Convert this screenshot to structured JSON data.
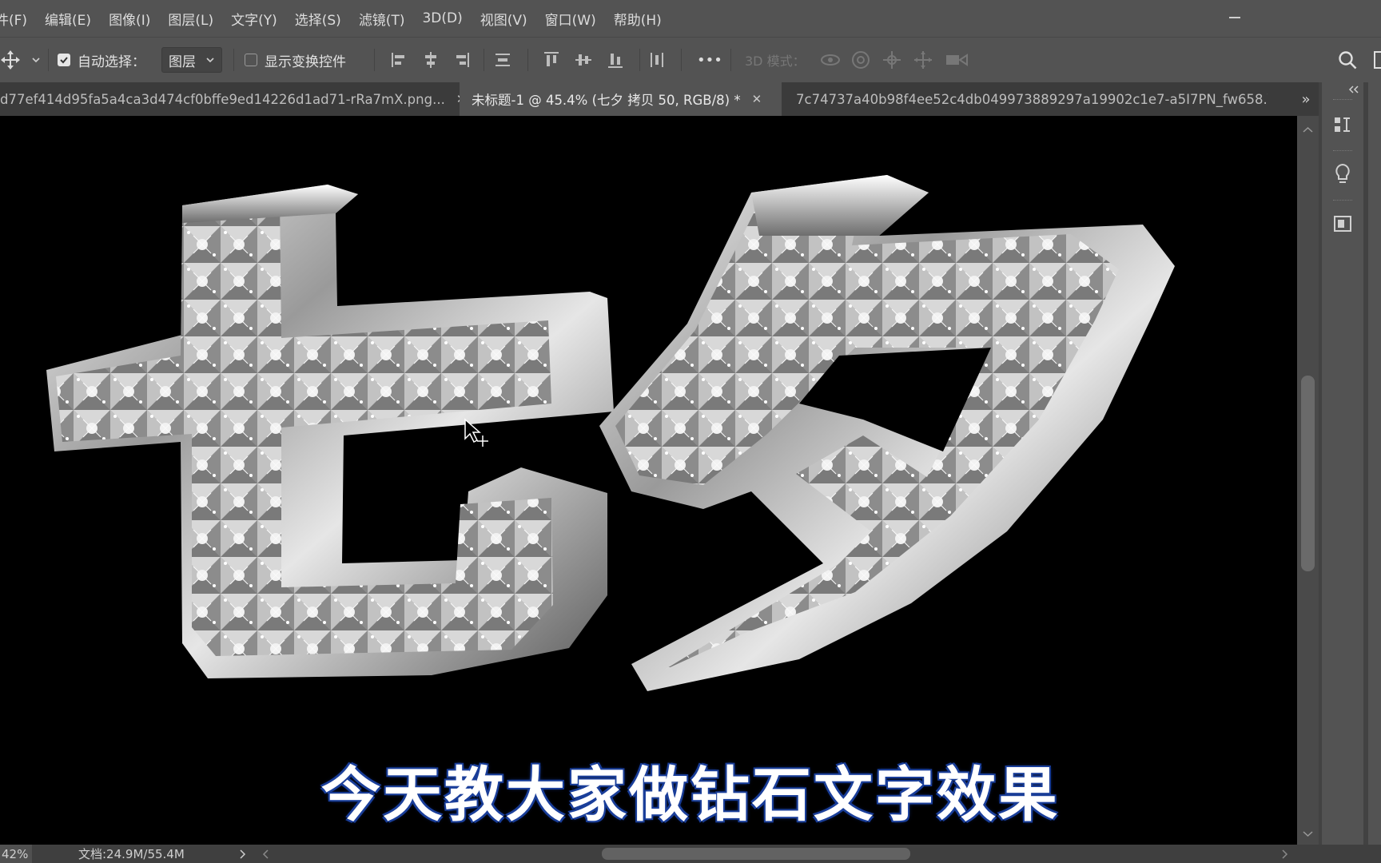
{
  "menu": {
    "items": [
      "件(F)",
      "编辑(E)",
      "图像(I)",
      "图层(L)",
      "文字(Y)",
      "选择(S)",
      "滤镜(T)",
      "3D(D)",
      "视图(V)",
      "窗口(W)",
      "帮助(H)"
    ]
  },
  "options_bar": {
    "auto_select_label": "自动选择：",
    "auto_select_checked": true,
    "target_value": "图层",
    "show_transform_label": "显示变换控件",
    "show_transform_checked": false,
    "more_label": "•••",
    "mode_3d_label": "3D 模式："
  },
  "tabs": [
    {
      "label": "d77ef414d95fa5a4ca3d474cf0bffe9ed14226d1ad71-rRa7mX.png...",
      "active": false
    },
    {
      "label": "未标题-1 @ 45.4% (七夕 拷贝 50, RGB/8) *",
      "active": true
    },
    {
      "label": "7c74737a40b98f4ee52c4db049973889297a19902c1e7-a5I7PN_fw658.\\",
      "active": false
    }
  ],
  "tab_overflow_label": "»",
  "canvas": {
    "artwork_text": "七夕",
    "caption": "今天教大家做钻石文字效果"
  },
  "status": {
    "zoom": "42%",
    "doc_info": "文档:24.9M/55.4M"
  },
  "colors": {
    "ui_bg": "#535353",
    "canvas_bg": "#000000",
    "caption_outline": "#1b3f9a"
  }
}
